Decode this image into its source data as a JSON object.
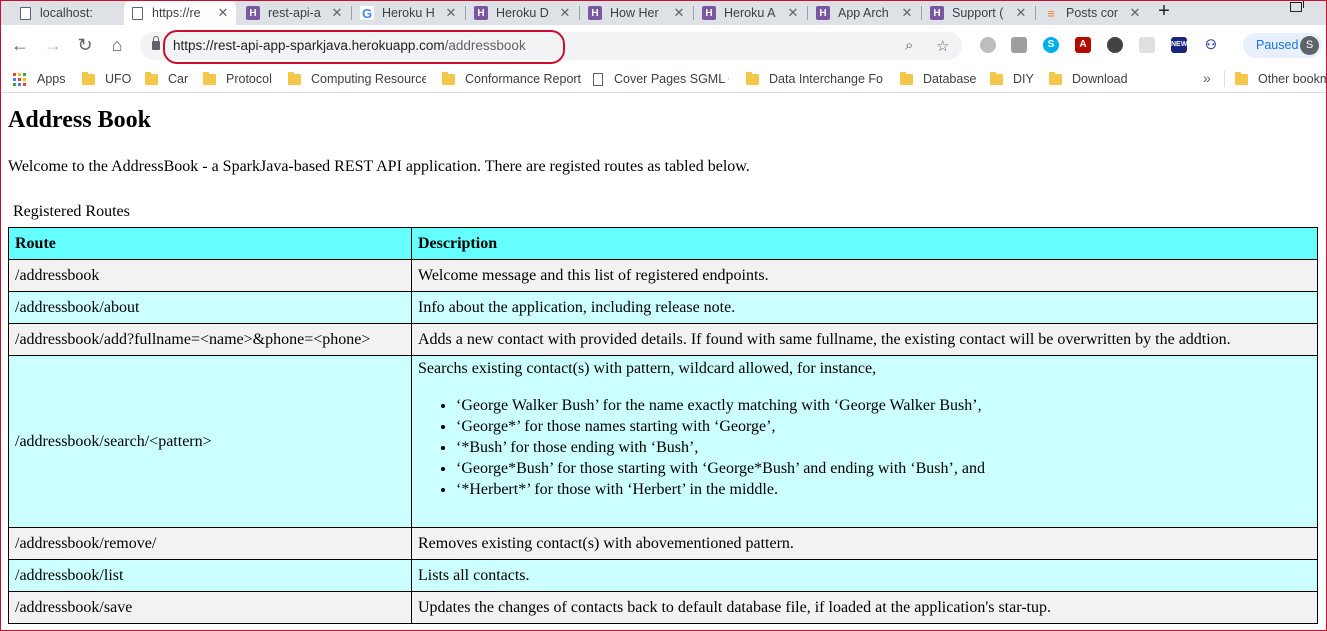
{
  "browser": {
    "tabs": [
      {
        "title": "localhost:",
        "favicon": "page-icon",
        "active": false
      },
      {
        "title": "https://re",
        "favicon": "page-icon",
        "active": true
      },
      {
        "title": "rest-api-a",
        "favicon": "heroku-icon",
        "active": false
      },
      {
        "title": "Heroku H",
        "favicon": "google-icon",
        "active": false
      },
      {
        "title": "Heroku D",
        "favicon": "heroku-icon",
        "active": false
      },
      {
        "title": "How Her",
        "favicon": "heroku-icon",
        "active": false
      },
      {
        "title": "Heroku A",
        "favicon": "heroku-icon",
        "active": false
      },
      {
        "title": "App Arch",
        "favicon": "heroku-icon",
        "active": false
      },
      {
        "title": "Support (",
        "favicon": "heroku-icon",
        "active": false
      },
      {
        "title": "Posts cor",
        "favicon": "stackoverflow-icon",
        "active": false
      }
    ],
    "new_tab": "+",
    "url_host": "https://rest-api-app-sparkjava.herokuapp.com",
    "url_path": "/addressbook",
    "paused_label": "Paused",
    "profile_initial": "S",
    "bookmarks": [
      {
        "label": "Apps",
        "icon": "apps-grid-icon"
      },
      {
        "label": "UFO",
        "icon": "folder-icon"
      },
      {
        "label": "Car",
        "icon": "folder-icon"
      },
      {
        "label": "Protocol",
        "icon": "folder-icon"
      },
      {
        "label": "Computing Resources",
        "icon": "folder-icon"
      },
      {
        "label": "Conformance Report",
        "icon": "folder-icon"
      },
      {
        "label": "Cover Pages SGML G",
        "icon": "page-icon"
      },
      {
        "label": "Data Interchange For",
        "icon": "folder-icon"
      },
      {
        "label": "Database",
        "icon": "folder-icon"
      },
      {
        "label": "DIY",
        "icon": "folder-icon"
      },
      {
        "label": "Download",
        "icon": "folder-icon"
      },
      {
        "label": "Other bookmarks",
        "icon": "folder-icon"
      }
    ],
    "overflow": "»"
  },
  "page": {
    "title": "Address Book",
    "welcome": "Welcome to the AddressBook - a SparkJava-based REST API application. There are registed routes as tabled below.",
    "caption": "Registered Routes",
    "headers": {
      "route": "Route",
      "description": "Description"
    },
    "rows": [
      {
        "route": "/addressbook",
        "description": "Welcome message and this list of registered endpoints."
      },
      {
        "route": "/addressbook/about",
        "description": "Info about the application, including release note."
      },
      {
        "route": "/addressbook/add?fullname=<name>&phone=<phone>",
        "description": "Adds a new contact with provided details. If found with same fullname, the existing contact will be overwritten by the addtion."
      },
      {
        "route": "/addressbook/search/<pattern>",
        "description": "Searchs existing contact(s) with pattern, wildcard allowed, for instance,",
        "bullets": [
          "‘George Walker Bush’ for the name exactly matching with ‘George Walker Bush’,",
          "‘George*’ for those names starting with ‘George’,",
          "‘*Bush’ for those ending with ‘Bush’,",
          "‘George*Bush’ for those starting with ‘George*Bush’ and ending with ‘Bush’, and",
          "‘*Herbert*’ for those with ‘Herbert’ in the middle."
        ]
      },
      {
        "route": "/addressbook/remove/",
        "description": "Removes existing contact(s) with abovementioned pattern."
      },
      {
        "route": "/addressbook/list",
        "description": "Lists all contacts."
      },
      {
        "route": "/addressbook/save",
        "description": "Updates the changes of contacts back to default database file, if loaded at the application's star-tup."
      }
    ]
  }
}
